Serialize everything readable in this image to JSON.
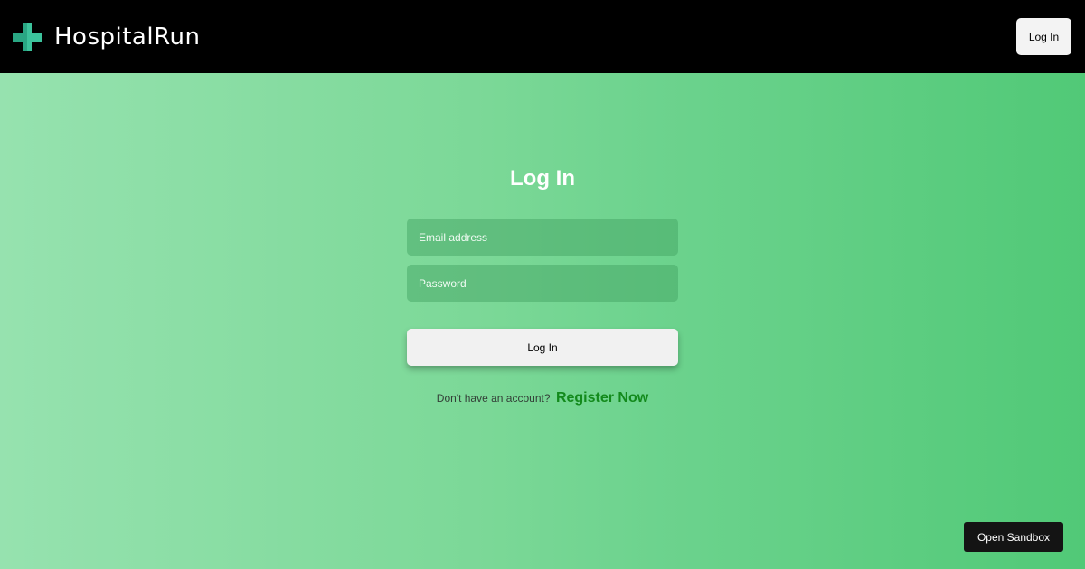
{
  "header": {
    "brand": "HospitalRun",
    "brand_icon": "medical-cross-icon",
    "login_label": "Log In"
  },
  "login_form": {
    "title": "Log In",
    "email_placeholder": "Email address",
    "password_placeholder": "Password",
    "submit_label": "Log In",
    "register_prompt": "Don't have an account?",
    "register_link": "Register Now"
  },
  "sandbox": {
    "label": "Open Sandbox"
  },
  "colors": {
    "topbar": "#000000",
    "brand_icon": "#3cc39c",
    "gradient_start": "#96e2af",
    "gradient_end": "#51c977",
    "register_link": "#138a1c",
    "sandbox_button": "#141414"
  }
}
